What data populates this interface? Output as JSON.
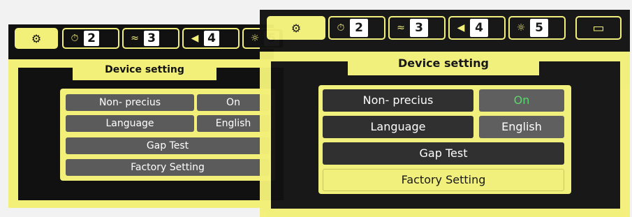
{
  "topbar": {
    "items": [
      {
        "icon": "gear-icon",
        "num": ""
      },
      {
        "icon": "timer-icon",
        "num": "2"
      },
      {
        "icon": "signal-icon",
        "num": "3"
      },
      {
        "icon": "speaker-icon",
        "num": "4"
      },
      {
        "icon": "brightness-icon",
        "num": "5"
      },
      {
        "icon": "battery-icon",
        "num": ""
      }
    ]
  },
  "screen": {
    "title": "Device setting",
    "rows": [
      {
        "label": "Non- precius",
        "value": "On"
      },
      {
        "label": "Language",
        "value": "English"
      },
      {
        "label": "Gap Test",
        "value": ""
      },
      {
        "label": "Factory Setting",
        "value": ""
      }
    ]
  },
  "colors": {
    "accent": "#f3f07a",
    "background": "#111111",
    "on": "#58d66b"
  }
}
